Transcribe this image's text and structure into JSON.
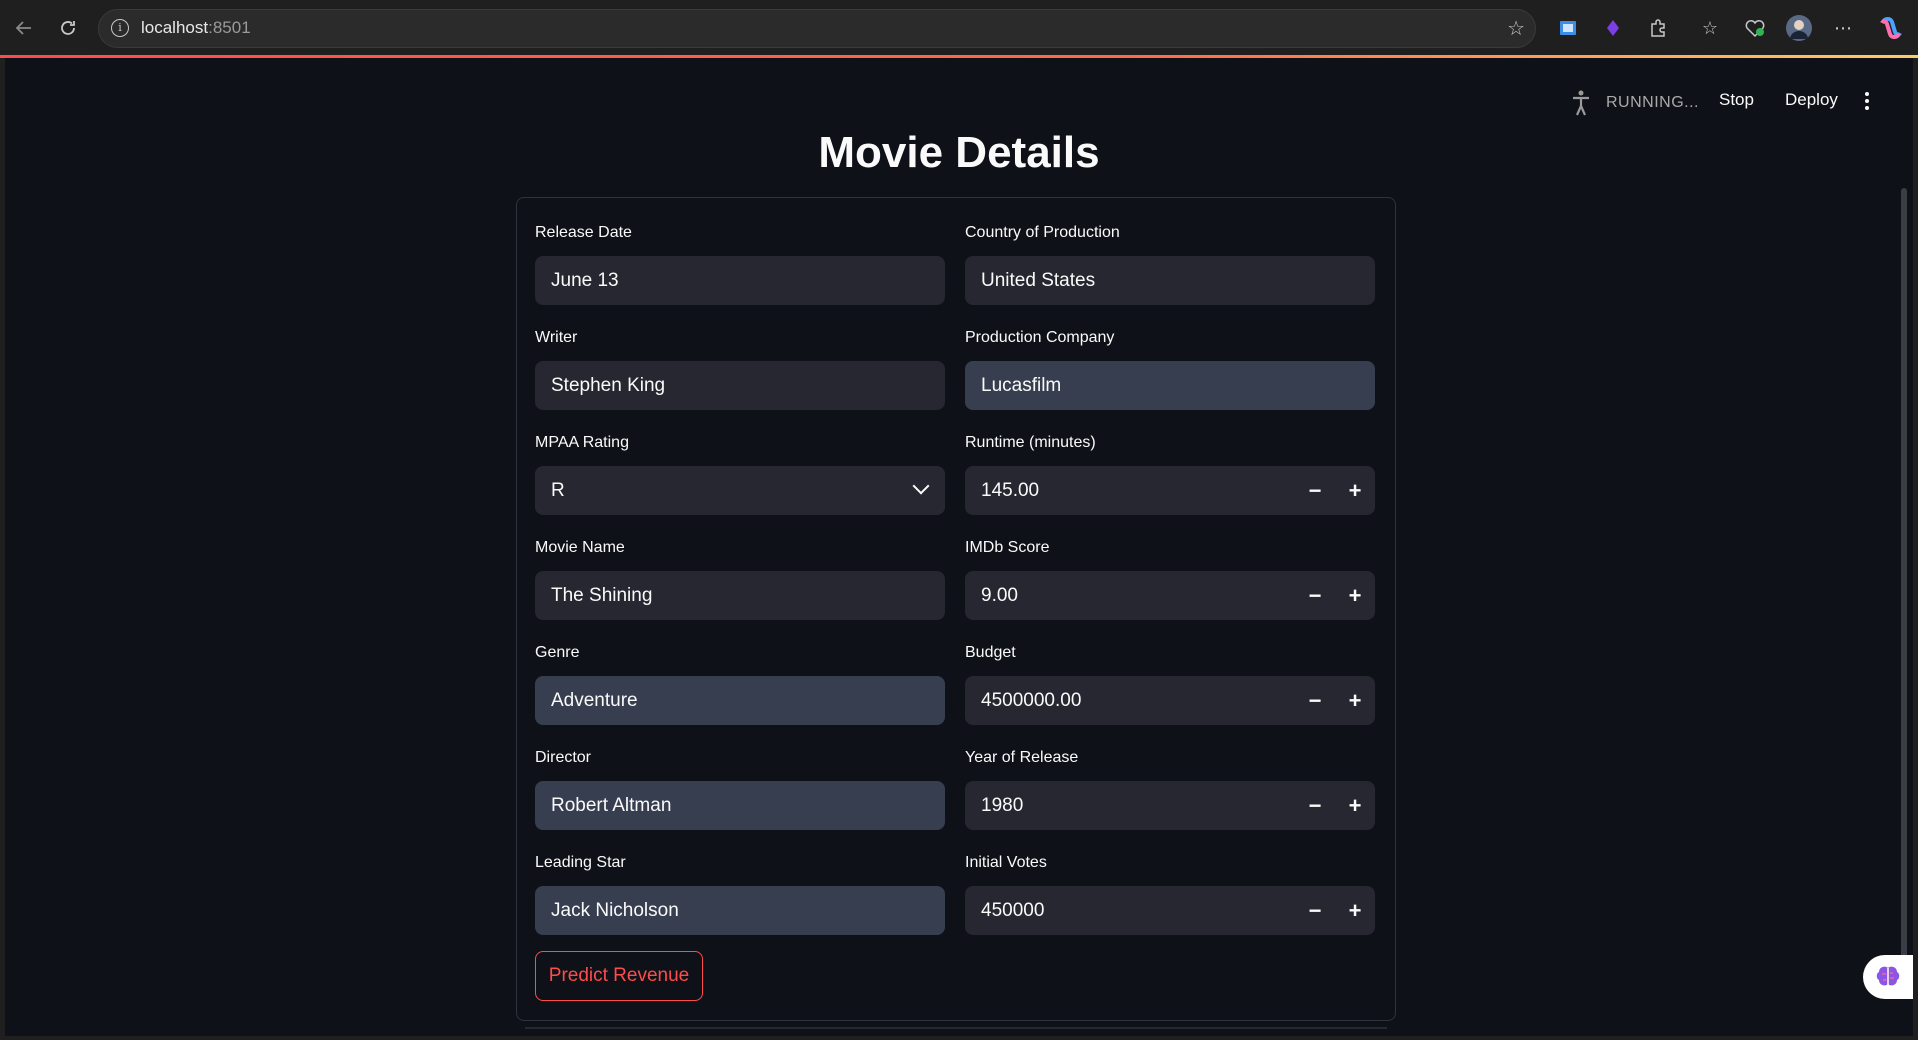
{
  "browser": {
    "url_host": "localhost",
    "url_port": ":8501",
    "back_icon": "arrow-left-icon",
    "reload_icon": "reload-icon"
  },
  "toolbar": {
    "status": "RUNNING...",
    "stop_label": "Stop",
    "deploy_label": "Deploy"
  },
  "page": {
    "title": "Movie Details"
  },
  "form": {
    "left": [
      {
        "label": "Release Date",
        "value": "June 13",
        "kind": "text"
      },
      {
        "label": "Writer",
        "value": "Stephen King",
        "kind": "text"
      },
      {
        "label": "MPAA Rating",
        "value": "R",
        "kind": "select"
      },
      {
        "label": "Movie Name",
        "value": "The Shining",
        "kind": "text"
      },
      {
        "label": "Genre",
        "value": "Adventure",
        "kind": "text-filled"
      },
      {
        "label": "Director",
        "value": "Robert Altman",
        "kind": "text-filled"
      },
      {
        "label": "Leading Star",
        "value": "Jack Nicholson",
        "kind": "text-filled"
      }
    ],
    "right": [
      {
        "label": "Country of Production",
        "value": "United States",
        "kind": "text"
      },
      {
        "label": "Production Company",
        "value": "Lucasfilm",
        "kind": "text-filled"
      },
      {
        "label": "Runtime (minutes)",
        "value": "145.00",
        "kind": "number"
      },
      {
        "label": "IMDb Score",
        "value": "9.00",
        "kind": "number"
      },
      {
        "label": "Budget",
        "value": "4500000.00",
        "kind": "number"
      },
      {
        "label": "Year of Release",
        "value": "1980",
        "kind": "number"
      },
      {
        "label": "Initial Votes",
        "value": "450000",
        "kind": "number"
      }
    ],
    "submit_label": "Predict Revenue",
    "stepper_minus": "−",
    "stepper_plus": "+"
  },
  "colors": {
    "accent": "#ff4b4b",
    "background": "#0e1117",
    "input_bg": "#262730",
    "input_filled_bg": "#373e4f"
  }
}
